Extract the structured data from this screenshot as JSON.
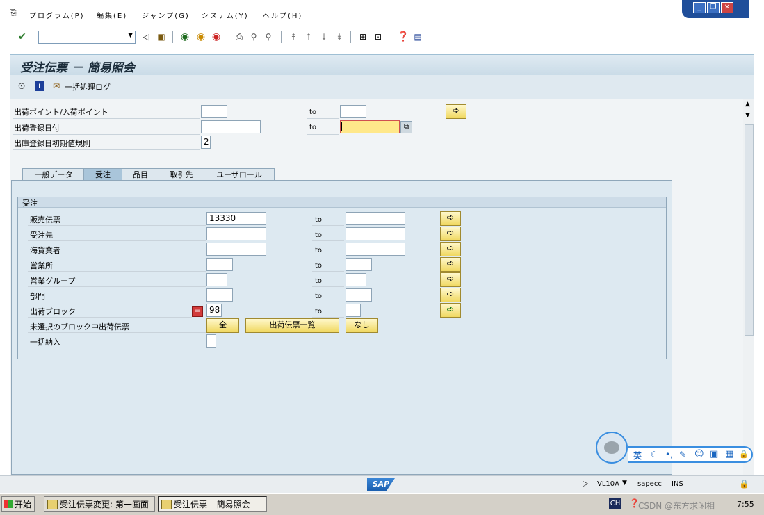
{
  "menu": {
    "items": [
      "プログラム(P)",
      "編集(E)",
      "ジャンプ(G)",
      "システム(Y)",
      "ヘルプ(H)"
    ],
    "window_controls": [
      "_",
      "❐",
      "✕"
    ]
  },
  "toolbar": {
    "command_field_value": "",
    "icons": [
      "enter-icon",
      "back-icon",
      "save-icon",
      "back-arrow-icon",
      "exit-icon",
      "cancel-icon",
      "print-icon",
      "find-icon",
      "find-next-icon",
      "first-page-icon",
      "prev-page-icon",
      "next-page-icon",
      "last-page-icon",
      "create-session-icon",
      "shortcut-icon",
      "help-icon",
      "layout-icon"
    ]
  },
  "title": "受注伝票 － 簡易照会",
  "app_toolbar": {
    "log_label": "一括処理ログ"
  },
  "header_fields": [
    {
      "label": "出荷ポイント/入荷ポイント",
      "from": "",
      "to_label": "to",
      "to": "",
      "has_select": true
    },
    {
      "label": "出荷登録日付",
      "from": "",
      "to_label": "to",
      "to": "",
      "has_select": false
    },
    {
      "label": "出庫登録日初期値規則",
      "from": "2"
    }
  ],
  "tabs": [
    {
      "label": "一般データ",
      "selected": false
    },
    {
      "label": "受注",
      "selected": true
    },
    {
      "label": "品目",
      "selected": false
    },
    {
      "label": "取引先",
      "selected": false
    },
    {
      "label": "ユーザロール",
      "selected": false
    }
  ],
  "group": {
    "title": "受注",
    "rows": [
      {
        "label": "販売伝票",
        "from": "13330",
        "to_label": "to",
        "to": ""
      },
      {
        "label": "受注先",
        "from": "",
        "to_label": "to",
        "to": ""
      },
      {
        "label": "海貨業者",
        "from": "",
        "to_label": "to",
        "to": ""
      },
      {
        "label": "営業所",
        "from": "",
        "to_label": "to",
        "to": ""
      },
      {
        "label": "営業グループ",
        "from": "",
        "to_label": "to",
        "to": ""
      },
      {
        "label": "部門",
        "from": "",
        "to_label": "to",
        "to": ""
      },
      {
        "label": "出荷ブロック",
        "from": "98",
        "to_label": "to",
        "to": ""
      }
    ],
    "unselected_label": "未選択のブロック中出荷伝票",
    "btn_all": "全",
    "btn_list": "出荷伝票一覧",
    "btn_none": "なし",
    "bulk_label": "一括納入"
  },
  "status": {
    "logo": "SAP",
    "transaction": "VL10A",
    "server": "sapecc",
    "mode": "INS"
  },
  "taskbar": {
    "start": "开始",
    "tasks": [
      "受注伝票変更: 第一画面",
      "受注伝票 – 簡易照会"
    ],
    "lang": "CH",
    "clock": "7:55",
    "watermark": "CSDN @东方求闲相"
  },
  "ime": {
    "items": [
      "英",
      "☾",
      "•,",
      "✎",
      "☺",
      "▣",
      "▦",
      "🔒"
    ]
  }
}
